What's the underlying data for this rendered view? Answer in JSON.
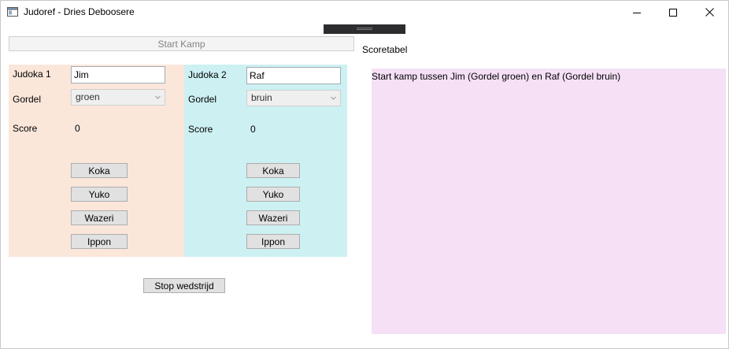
{
  "window": {
    "title": "Judoref - Dries Deboosere",
    "minimize_glyph": "—",
    "maximize_glyph": "☐",
    "close_glyph": "✕"
  },
  "toolbar": {
    "start_label": "Start Kamp",
    "scoreboard_label": "Scoretabel"
  },
  "judoka1": {
    "label": "Judoka 1",
    "name_value": "Jim",
    "belt_label": "Gordel",
    "belt_value": "groen",
    "score_label": "Score",
    "score_value": "0",
    "buttons": {
      "koka": "Koka",
      "yuko": "Yuko",
      "wazeri": "Wazeri",
      "ippon": "Ippon"
    }
  },
  "judoka2": {
    "label": "Judoka 2",
    "name_value": "Raf",
    "belt_label": "Gordel",
    "belt_value": "bruin",
    "score_label": "Score",
    "score_value": "0",
    "buttons": {
      "koka": "Koka",
      "yuko": "Yuko",
      "wazeri": "Wazeri",
      "ippon": "Ippon"
    }
  },
  "footer": {
    "stop_label": "Stop wedstrijd"
  },
  "scoreboard": {
    "log_text": "Start kamp tussen Jim (Gordel groen) en Raf (Gordel bruin)"
  },
  "colors": {
    "panel1": "#fbe6da",
    "panel2": "#cdf0f2",
    "scoreboard": "#f5e0f5"
  }
}
